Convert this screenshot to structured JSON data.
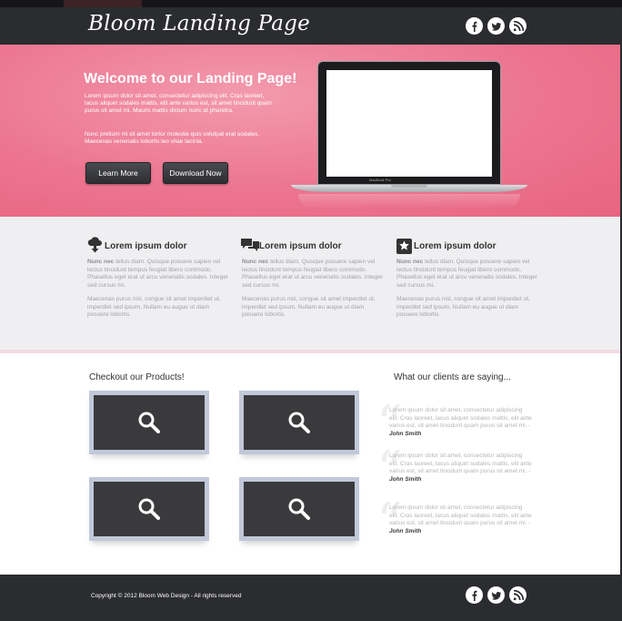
{
  "header": {
    "logo": "Bloom Landing Page",
    "social": [
      {
        "icon": "facebook-icon",
        "label": "f"
      },
      {
        "icon": "twitter-icon",
        "label": "t"
      },
      {
        "icon": "rss-icon",
        "label": "rss"
      }
    ]
  },
  "hero": {
    "title": "Welcome to our Landing Page!",
    "paragraph1": "Lorem ipsum dolor sit amet, consectetur adipiscing elit. Cras laoreet, lacus aliquet sodales mattis, elit ante varius est, sit amet tincidunt quam purus sit amet mi. Mauris mattis dictum nunc at pharetra.",
    "paragraph2": "Nunc pretium mi sit amet tortor molestie quis volutpat erat sodales. Maecenas venenatis lobortis leo vitae lacinia.",
    "learn_more": "Learn More",
    "download_now": "Download Now",
    "laptop_brand": "MacBook Pro"
  },
  "features": [
    {
      "icon": "cloud-download-icon",
      "title": "Lorem ipsum dolor",
      "lead": "Nunc nec",
      "text1": " tellus diam. Quisque posuere sapien vel lectus tincidunt tempus feugiat libero commodo. Phasellus eget erat ut arcu venenatis sodales. Integer sed cursus mi.",
      "text2": "Maecenas purus nisl, congue sit amet imperdiet ut, imperdiet sed ipsum. Nullam eu augue ut diam posuere lobortis."
    },
    {
      "icon": "chat-bubbles-icon",
      "title": "Lorem ipsum dolor",
      "lead": "Nunc nec",
      "text1": " tellus diam. Quisque posuere sapien vel lectus tincidunt tempus feugiat libero commodo. Phasellus eget erat ut arcu venenatis sodales. Integer sed cursus mi.",
      "text2": "Maecenas purus nisl, congue sit amet imperdiet ut, imperdiet sed ipsum. Nullam eu augue ut diam posuere lobortis."
    },
    {
      "icon": "star-icon",
      "title": "Lorem ipsum dolor",
      "lead": "Nunc nec",
      "text1": " tellus diam. Quisque posuere sapien vel lectus tincidunt tempus feugiat libero commodo. Phasellus eget erat ut arcu venenatis sodales. Integer sed cursus mi.",
      "text2": "Maecenas purus nisl, congue sit amet imperdiet ut, imperdiet sed ipsum. Nullam eu augue ut diam posuere lobortis."
    }
  ],
  "products": {
    "title": "Checkout our Products!",
    "items": [
      {
        "icon": "magnifier-icon"
      },
      {
        "icon": "magnifier-icon"
      },
      {
        "icon": "magnifier-icon"
      },
      {
        "icon": "magnifier-icon"
      }
    ]
  },
  "testimonials": {
    "title": "What our clients are saying...",
    "items": [
      {
        "text": "Lorem ipsum dolor sit amet, consectetur adipiscing elit. Cras laoreet, lacus aliquet sodales mattis, elit ante varius est, sit amet tincidunt quam purus sit amet mi. -",
        "author": "John Smith"
      },
      {
        "text": "Lorem ipsum dolor sit amet, consectetur adipiscing elit. Cras laoreet, lacus aliquet sodales mattis, elit ante varius est, sit amet tincidunt quam purus sit amet mi. -",
        "author": "John Smith"
      },
      {
        "text": "Lorem ipsum dolor sit amet, consectetur adipiscing elit. Cras laoreet, lacus aliquet sodales mattis, elit ante varius est, sit amet tincidunt quam purus sit amet mi. -",
        "author": "John Smith"
      }
    ]
  },
  "footer": {
    "copyright": "Copyright © 2012 Bloom Web Design - All rights reserved"
  },
  "colors": {
    "dark": "#2b2c30",
    "pink": "#ec7590",
    "light_gray": "#efeff1",
    "frame_blue": "#c1c8d9"
  }
}
